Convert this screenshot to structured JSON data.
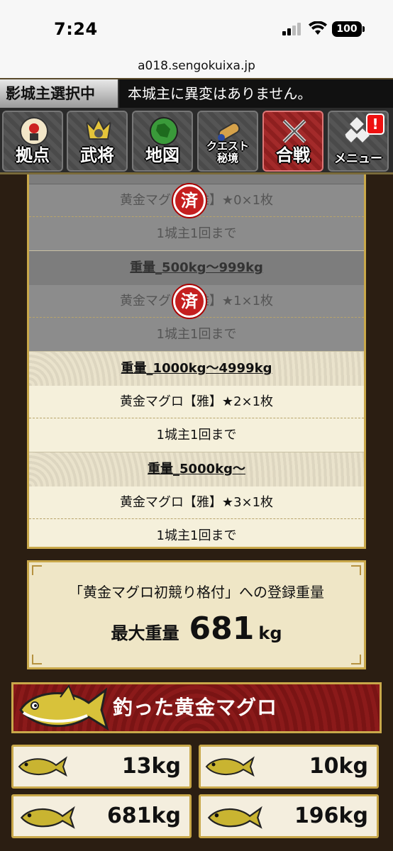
{
  "status_bar": {
    "time": "7:24",
    "battery": "100"
  },
  "browser": {
    "url": "a018.sengokuixa.jp"
  },
  "header": {
    "tag": "影城主選択中",
    "message": "本城主に異変はありません。"
  },
  "nav": [
    {
      "label": "拠点",
      "icon": "castle-icon"
    },
    {
      "label": "武将",
      "icon": "general-icon"
    },
    {
      "label": "地図",
      "icon": "map-icon"
    },
    {
      "label_line1": "クエスト",
      "label_line2": "秘境",
      "icon": "scroll-icon"
    },
    {
      "label": "合戦",
      "icon": "battle-icon",
      "active": true
    },
    {
      "label": "メニュー",
      "icon": "menu-icon",
      "badge": "!"
    }
  ],
  "rewards": {
    "partial_item": "黄金マグロ【雅】★0×1枚",
    "partial_limit": "1城主1回まで",
    "stamp_text": "済",
    "tiers": [
      {
        "range": "重量_500kg〜999kg",
        "item": "黄金マグロ【雅】★1×1枚",
        "limit": "1城主1回まで",
        "claimed": true
      },
      {
        "range": "重量_1000kg〜4999kg",
        "item": "黄金マグロ【雅】★2×1枚",
        "limit": "1城主1回まで",
        "claimed": false
      },
      {
        "range": "重量_5000kg〜",
        "item": "黄金マグロ【雅】★3×1枚",
        "limit": "1城主1回まで",
        "claimed": false
      }
    ]
  },
  "weight_panel": {
    "title": "「黄金マグロ初競り格付」への登録重量",
    "label": "最大重量",
    "value": "681",
    "unit": "kg"
  },
  "caught": {
    "title": "釣った黄金マグロ",
    "fish": [
      "13kg",
      "10kg",
      "681kg",
      "196kg"
    ]
  },
  "colors": {
    "gold_border": "#c9a84a",
    "banner_red": "#8b1a1a",
    "stamp_red": "#c51f1f"
  }
}
